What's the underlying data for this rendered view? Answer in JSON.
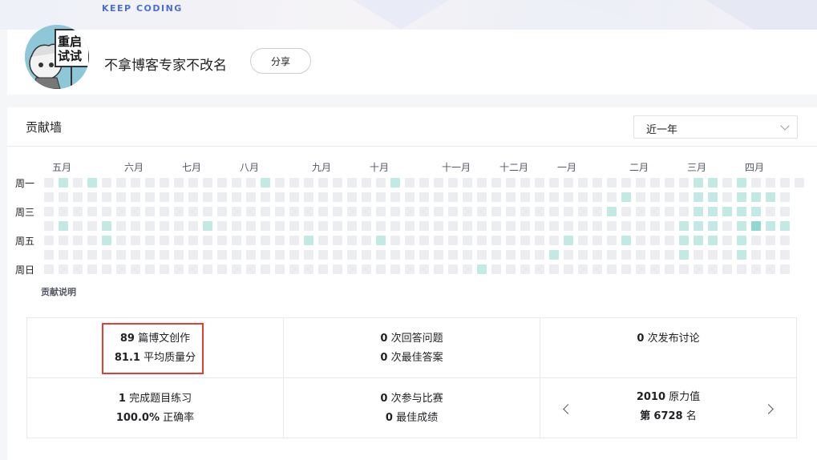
{
  "banner": {
    "text": "KEEP CODING"
  },
  "profile": {
    "nickname": "不拿博客专家不改名",
    "share_label": "分享",
    "avatar_sign_text": "重启试试"
  },
  "contribution": {
    "title": "贡献墙",
    "range_select": {
      "value": "近一年"
    },
    "months": [
      "五月",
      "六月",
      "七月",
      "八月",
      "九月",
      "十月",
      "十一月",
      "十二月",
      "一月",
      "二月",
      "三月",
      "四月"
    ],
    "weekdays": [
      "周一",
      "周三",
      "周五",
      "周日"
    ],
    "legend_link": "贡献说明",
    "colors": {
      "empty": "#ebedf0",
      "level1": "#c3e9e5",
      "level2": "#8fd9cf"
    }
  },
  "stats": {
    "blog": {
      "count": "89",
      "count_label": "篇博文创作",
      "score": "81.1",
      "score_label": "平均质量分"
    },
    "answers": {
      "count": "0",
      "count_label": "次回答问题",
      "best": "0",
      "best_label": "次最佳答案"
    },
    "discussions": {
      "count": "0",
      "count_label": "次发布讨论"
    },
    "exercises": {
      "count": "1",
      "count_label": "完成题目练习",
      "rate": "100.0%",
      "rate_label": "正确率"
    },
    "contests": {
      "count": "0",
      "count_label": "次参与比赛",
      "best": "0",
      "best_label": "最佳成绩"
    },
    "power": {
      "value": "2010",
      "value_label": "原力值",
      "rank_prefix": "第",
      "rank": "6728",
      "rank_suffix": "名"
    }
  }
}
